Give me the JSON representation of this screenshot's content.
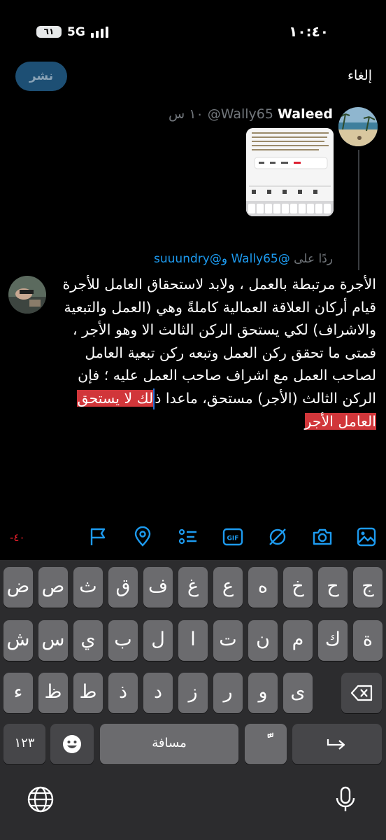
{
  "status_bar": {
    "time": "١٠:٤٠",
    "network": "5G",
    "battery": "٦١"
  },
  "header": {
    "publish_label": "نشر",
    "cancel_label": "إلغاء"
  },
  "original_tweet": {
    "author_name": "Waleed",
    "handle": "@Wally65",
    "time": "١٠ س"
  },
  "reply_context": {
    "prefix": "ردًا على",
    "handles": "@Wally65 و@suuundry"
  },
  "compose": {
    "text_before_selection": "الأجرة مرتبطة بالعمل ، ولابد لاستحقاق العامل للأجرة قيام أركان العلاقة العمالية كاملةً وهي (العمل والتبعية والاشراف) لكي يستحق الركن الثالث الا وهو الأجر ، فمتى ما تحقق ركن العمل وتبعه ركن تبعية العامل لصاحب العمل مع اشراف صاحب العمل عليه ؛ فإن الركن الثالث (الأجر) مستحق، ماعدا ذ",
    "selected_text": "لك لا يستحق العامل الأجر"
  },
  "toolbar": {
    "char_count": "-٤٠",
    "icons": [
      "image-icon",
      "camera-icon",
      "grok-icon",
      "gif-icon",
      "poll-icon",
      "location-icon",
      "flag-icon"
    ]
  },
  "keyboard": {
    "row1": [
      "ج",
      "ح",
      "خ",
      "ه",
      "ع",
      "غ",
      "ف",
      "ق",
      "ث",
      "ص",
      "ض"
    ],
    "row2": [
      "ة",
      "ك",
      "م",
      "ن",
      "ت",
      "ا",
      "ل",
      "ب",
      "ي",
      "س",
      "ش"
    ],
    "row3": [
      "ى",
      "و",
      "ر",
      "ز",
      "د",
      "ذ",
      "ط",
      "ظ",
      "ء"
    ],
    "numbers_label": "١٢٣",
    "space_label": "مسافة",
    "diacritic_label": "ًّ"
  },
  "colors": {
    "accent": "#1d9bf0",
    "publish_bg": "#1d4f74",
    "selection": "#d1363a",
    "warning": "#f4212e"
  }
}
